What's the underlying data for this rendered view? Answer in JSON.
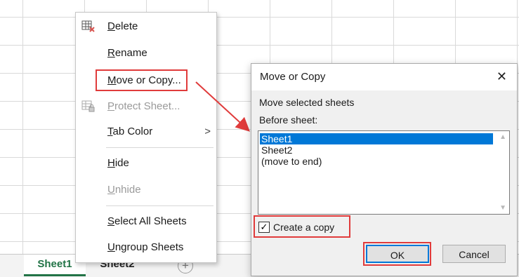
{
  "sheets": {
    "tabs": [
      {
        "label": "Sheet1"
      },
      {
        "label": "Sheet2"
      }
    ],
    "add_icon": "plus-circle-icon"
  },
  "context_menu": {
    "items": [
      {
        "label": "Delete",
        "mnemonic": "D",
        "rest": "elete",
        "icon": "delete-sheet-icon"
      },
      {
        "label": "Rename",
        "mnemonic": "R",
        "rest": "ename"
      },
      {
        "label": "Move or Copy...",
        "mnemonic": "M",
        "rest": "ove or Copy..."
      },
      {
        "label": "Protect Sheet...",
        "mnemonic": "P",
        "rest": "rotect Sheet...",
        "icon": "protect-sheet-icon"
      },
      {
        "label": "Tab Color",
        "mnemonic": "T",
        "rest": "ab Color",
        "arrow": ">"
      },
      {
        "label": "Hide",
        "mnemonic": "H",
        "rest": "ide"
      },
      {
        "label": "Unhide",
        "mnemonic": "U",
        "rest": "nhide"
      },
      {
        "label": "Select All Sheets",
        "mnemonic": "S",
        "rest": "elect All Sheets"
      },
      {
        "label": "Ungroup Sheets",
        "mnemonic": "U",
        "rest": "ngroup Sheets"
      }
    ]
  },
  "dialog": {
    "title": "Move or Copy",
    "close": "✕",
    "move_label": "Move selected sheets",
    "before_label": "Before sheet:",
    "list": [
      "Sheet1",
      "Sheet2",
      "(move to end)"
    ],
    "create_copy_label": "Create a copy",
    "create_copy_checked": "✓",
    "ok": "OK",
    "cancel": "Cancel"
  },
  "colors": {
    "highlight": "#e03b3b",
    "selection": "#0078d7",
    "sheet_active": "#217346"
  }
}
